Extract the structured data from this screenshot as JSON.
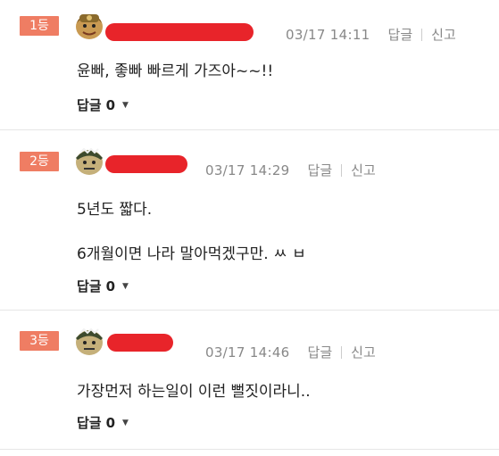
{
  "comments": [
    {
      "rank": "1등",
      "time": "03/17 14:11",
      "reply_action": "답글",
      "report_action": "신고",
      "lines": [
        "윤빠, 좋빠 빠르게 가즈아~~!!"
      ],
      "reply_label": "답글",
      "reply_count": "0",
      "caret": "▼"
    },
    {
      "rank": "2등",
      "time": "03/17 14:29",
      "reply_action": "답글",
      "report_action": "신고",
      "lines": [
        "5년도 짧다.",
        "6개월이면 나라 말아먹겠구만. ㅆ ㅂ"
      ],
      "reply_label": "답글",
      "reply_count": "0",
      "caret": "▼"
    },
    {
      "rank": "3등",
      "time": "03/17 14:46",
      "reply_action": "답글",
      "report_action": "신고",
      "lines": [
        "가장먼저 하는일이 이런 뻘짓이라니.."
      ],
      "reply_label": "답글",
      "reply_count": "0",
      "caret": "▼"
    }
  ],
  "colors": {
    "rank_badge": "#ef7d63",
    "redaction": "#e8242a",
    "meta_text": "#888888"
  }
}
